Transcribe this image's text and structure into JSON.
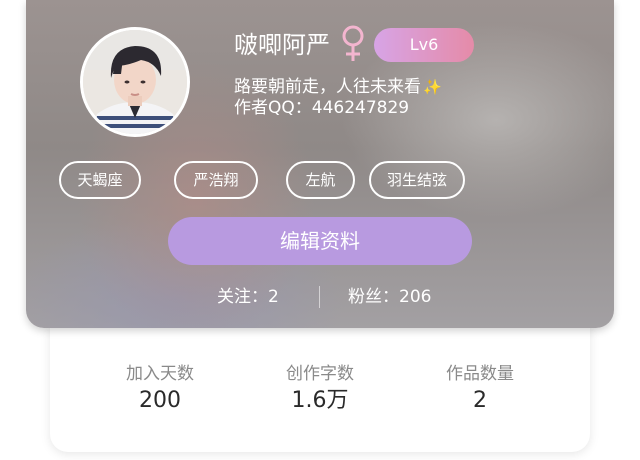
{
  "profile": {
    "username": "啵唧阿严",
    "gender_icon": "female-symbol-icon",
    "level": "Lv6",
    "bio": "路要朝前走，人往未来看",
    "bio_sparkle": "✨",
    "author_qq": "作者QQ：446247829",
    "tags": [
      "天蝎座",
      "严浩翔",
      "左航",
      "羽生结弦"
    ],
    "edit_button": "编辑资料",
    "following_label": "关注：2",
    "followers_label": "粉丝：206"
  },
  "stats": [
    {
      "label": "加入天数",
      "value": "200"
    },
    {
      "label": "创作字数",
      "value": "1.6万"
    },
    {
      "label": "作品数量",
      "value": "2"
    }
  ],
  "colors": {
    "accent_top": "#3ea6ea",
    "edit_button": "#b89ae0",
    "gender_icon": "#f3b5cf",
    "level_badge_start": "#d7a4e6",
    "level_badge_end": "#e58ba8"
  }
}
